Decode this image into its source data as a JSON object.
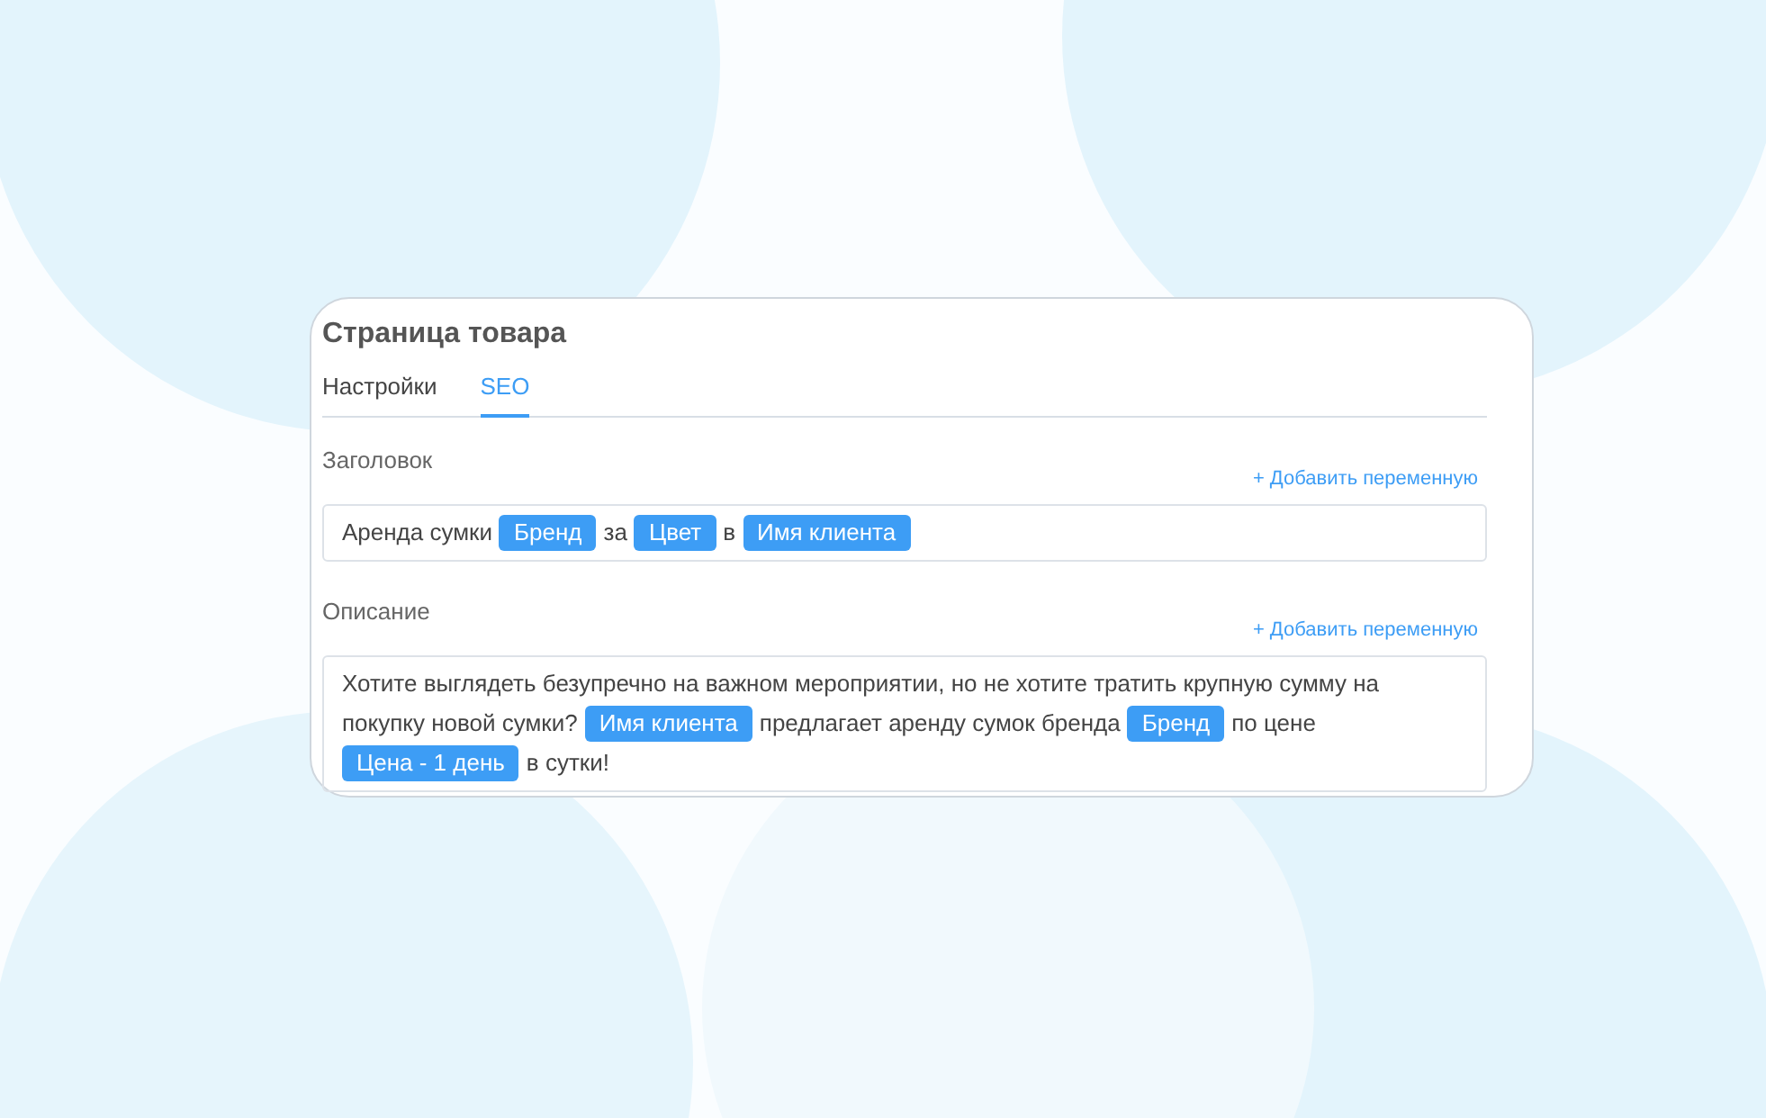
{
  "card": {
    "title": "Страница товара"
  },
  "tabs": [
    {
      "label": "Настройки",
      "selected": false
    },
    {
      "label": "SEO",
      "selected": true
    }
  ],
  "fields": [
    {
      "label": "Заголовок",
      "action": "+ Добавить переменную",
      "segments": [
        {
          "kind": "text",
          "text": "Аренда сумки"
        },
        {
          "kind": "variable",
          "text": "Бренд"
        },
        {
          "kind": "text",
          "text": "за"
        },
        {
          "kind": "variable",
          "text": "Цвет"
        },
        {
          "kind": "text",
          "text": "в"
        },
        {
          "kind": "variable",
          "text": "Имя клиента"
        }
      ]
    },
    {
      "label": "Описание",
      "action": "+ Добавить переменную",
      "segments": [
        {
          "kind": "text",
          "text": "Хотите выглядеть безупречно на важном мероприятии, но не хотите тратить крупную сумму на"
        },
        {
          "kind": "text",
          "text": "покупку новой сумки?"
        },
        {
          "kind": "variable",
          "text": "Имя клиента"
        },
        {
          "kind": "text",
          "text": "предлагает аренду сумок бренда"
        },
        {
          "kind": "variable",
          "text": "Бренд"
        },
        {
          "kind": "text",
          "text": "по цене"
        },
        {
          "kind": "variable",
          "text": "Цена - 1 день"
        },
        {
          "kind": "text",
          "text": "в сутки!"
        }
      ]
    }
  ]
}
